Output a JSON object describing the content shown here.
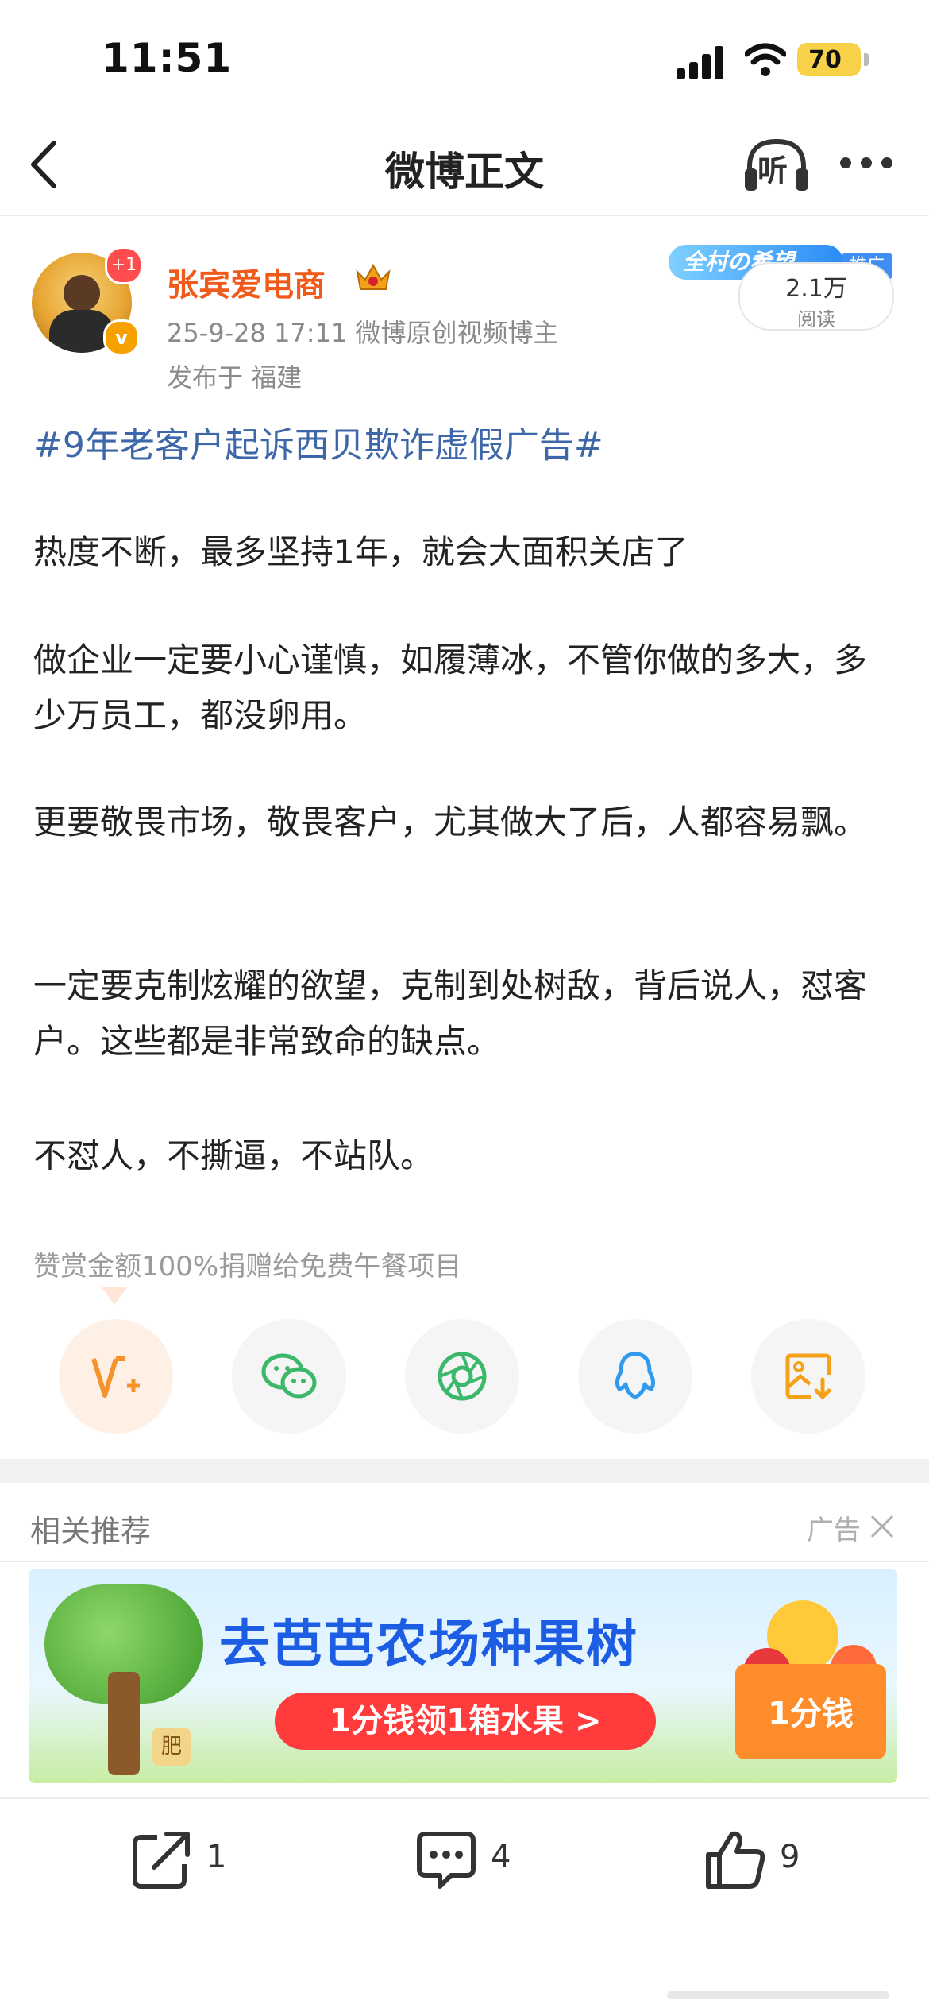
{
  "status_bar": {
    "time": "11:51",
    "battery": "70"
  },
  "nav": {
    "title": "微博正文",
    "listen_label": "听"
  },
  "author": {
    "avatar_badge": "+1",
    "verified_badge": "v",
    "name": "张宾爱电商",
    "time_source": "25-9-28 17:11  微博原创视频博主",
    "location": "发布于 福建"
  },
  "promo": {
    "banner_text": "全村の希望",
    "tag": "推广",
    "read_count": "2.1万",
    "read_label": "阅读"
  },
  "post": {
    "topic": "#9年老客户起诉西贝欺诈虚假广告#",
    "paragraphs": [
      "热度不断，最多坚持1年，就会大面积关店了",
      "做企业一定要小心谨慎，如履薄冰，不管你做的多大，多少万员工，都没卵用。",
      "更要敬畏市场，敬畏客户，尤其做大了后，人都容易飘。",
      "一定要克制炫耀的欲望，克制到处树敌，背后说人，怼客户。这些都是非常致命的缺点。",
      "不怼人，不撕逼，不站队。"
    ],
    "reward_note": "赞赏金额100%捐赠给免费午餐项目"
  },
  "share_buttons": [
    {
      "icon": "reward-v-plus-icon",
      "color": "#f5922b"
    },
    {
      "icon": "wechat-icon",
      "color": "#3cb86b"
    },
    {
      "icon": "moments-icon",
      "color": "#3cb86b"
    },
    {
      "icon": "qq-icon",
      "color": "#2e9bf0"
    },
    {
      "icon": "save-image-icon",
      "color": "#f5a21a"
    }
  ],
  "recommend": {
    "title": "相关推荐",
    "ad_label": "广告",
    "ad": {
      "headline": "去芭芭农场种果树",
      "cta": "1分钱领1箱水果 >",
      "box_text": "1分钱",
      "tree_label": "肥"
    }
  },
  "actions": {
    "repost_count": "1",
    "comment_count": "4",
    "like_count": "9"
  }
}
